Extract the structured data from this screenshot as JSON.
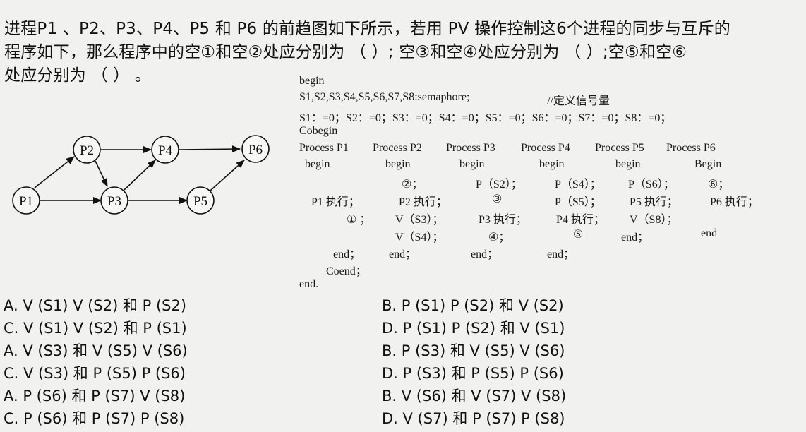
{
  "question": {
    "line1": "进程P1 、P2、P3、P4、P5 和 P6 的前趋图如下所示，若用 PV 操作控制这6个进程的同步与互斥的",
    "line2": "程序如下，那么程序中的空①和空②处应分别为 （ ）; 空③和空④处应分别为 （ ）;空⑤和空⑥",
    "line3": "处应分别为 （ ） 。"
  },
  "graph": {
    "nodes": [
      "P1",
      "P2",
      "P3",
      "P4",
      "P5",
      "P6"
    ],
    "edges": [
      [
        "P1",
        "P2"
      ],
      [
        "P1",
        "P3"
      ],
      [
        "P2",
        "P3"
      ],
      [
        "P2",
        "P4"
      ],
      [
        "P3",
        "P4"
      ],
      [
        "P3",
        "P5"
      ],
      [
        "P4",
        "P6"
      ],
      [
        "P5",
        "P6"
      ]
    ]
  },
  "code": {
    "begin": "begin",
    "decl": "S1,S2,S3,S4,S5,S6,S7,S8:semaphore;",
    "decl_comment": "//定义信号量",
    "init": "S1：=0；S2：=0；S3：=0；S4：=0；S5：=0；S6：=0；S7：=0；S8：=0；",
    "cobegin": "Cobegin",
    "proc1": "Process P1",
    "proc2": "Process P2",
    "proc3": "Process P3",
    "proc4": "Process P4",
    "proc5": "Process P5",
    "proc6": "Process P6",
    "b1": "begin",
    "b2": "begin",
    "b3": "begin",
    "b4": "begin",
    "b5": "begin",
    "b6": "Begin",
    "r1_p2": "②；",
    "r1_p3": "P（S2）；",
    "r1_p4": "P（S4）；",
    "r1_p5": "P（S6）；",
    "r1_p6": "⑥；",
    "r2_p1": "P1 执行；",
    "r2_p2": "P2 执行；",
    "r2_p3": "③",
    "r2_p4": "P（S5）；",
    "r2_p5": "P5 执行；",
    "r2_p6": "P6 执行；",
    "r3_p1": "① ；",
    "r3_p2": "V（S3）；",
    "r3_p3": "P3 执行；",
    "r3_p4": "P4 执行；",
    "r3_p5": "V（S8）；",
    "r4_p2": "V（S4）；",
    "r4_p3": "④；",
    "r4_p4": "⑤",
    "r4_p5": "end；",
    "r4_p6": "end",
    "end_p1": "end；",
    "end_p2": "end；",
    "end_p3": "end；",
    "end_p4": "end；",
    "coend": "Coend；",
    "end": "end."
  },
  "options": [
    [
      "A. V (S1) V (S2) 和 P (S2)",
      "B. P (S1) P (S2) 和 V (S2)"
    ],
    [
      "C. V (S1) V (S2) 和 P (S1)",
      "D. P (S1) P (S2) 和 V (S1)"
    ],
    [
      "A. V (S3) 和 V (S5) V (S6)",
      "B. P (S3) 和 V (S5) V (S6)"
    ],
    [
      "C. V (S3) 和 P (S5) P (S6)",
      "D. P (S3) 和 P (S5) P (S6)"
    ],
    [
      "A. P (S6) 和 P (S7) V (S8)",
      "B. V (S6) 和 V (S7) V (S8)"
    ],
    [
      "C. P (S6) 和 P (S7) P (S8)",
      "D. V (S7) 和 P (S7) P (S8)"
    ]
  ]
}
